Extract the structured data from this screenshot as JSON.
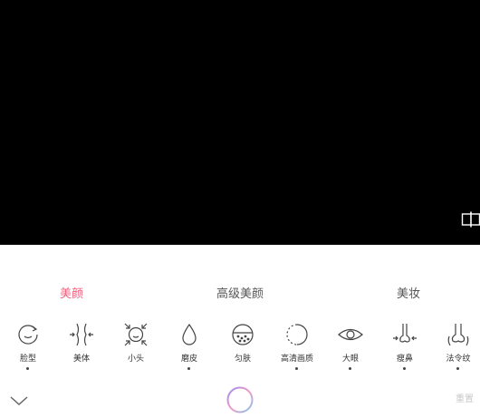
{
  "tabs": [
    {
      "label": "美颜",
      "active": true
    },
    {
      "label": "高级美颜",
      "active": false
    },
    {
      "label": "美妆",
      "active": false
    }
  ],
  "tools": [
    {
      "label": "脸型",
      "icon": "face-shape-icon",
      "dot": true
    },
    {
      "label": "美体",
      "icon": "body-slim-icon",
      "dot": false
    },
    {
      "label": "小头",
      "icon": "small-head-icon",
      "dot": false
    },
    {
      "label": "磨皮",
      "icon": "smooth-skin-drop-icon",
      "dot": true
    },
    {
      "label": "匀肤",
      "icon": "even-skin-icon",
      "dot": false
    },
    {
      "label": "高清画质",
      "icon": "hd-quality-icon",
      "dot": true
    },
    {
      "label": "大眼",
      "icon": "eye-icon",
      "dot": true
    },
    {
      "label": "瘦鼻",
      "icon": "nose-slim-icon",
      "dot": true
    },
    {
      "label": "法令纹",
      "icon": "nasolabial-fold-icon",
      "dot": true
    }
  ],
  "footer": {
    "reset_label": "重置",
    "collapse_icon": "chevron-down-icon",
    "center_icon": "gradient-ring-icon"
  },
  "compare_icon": "compare-split-icon",
  "colors": {
    "accent": "#f0607e",
    "preview_bg": "#000000"
  }
}
